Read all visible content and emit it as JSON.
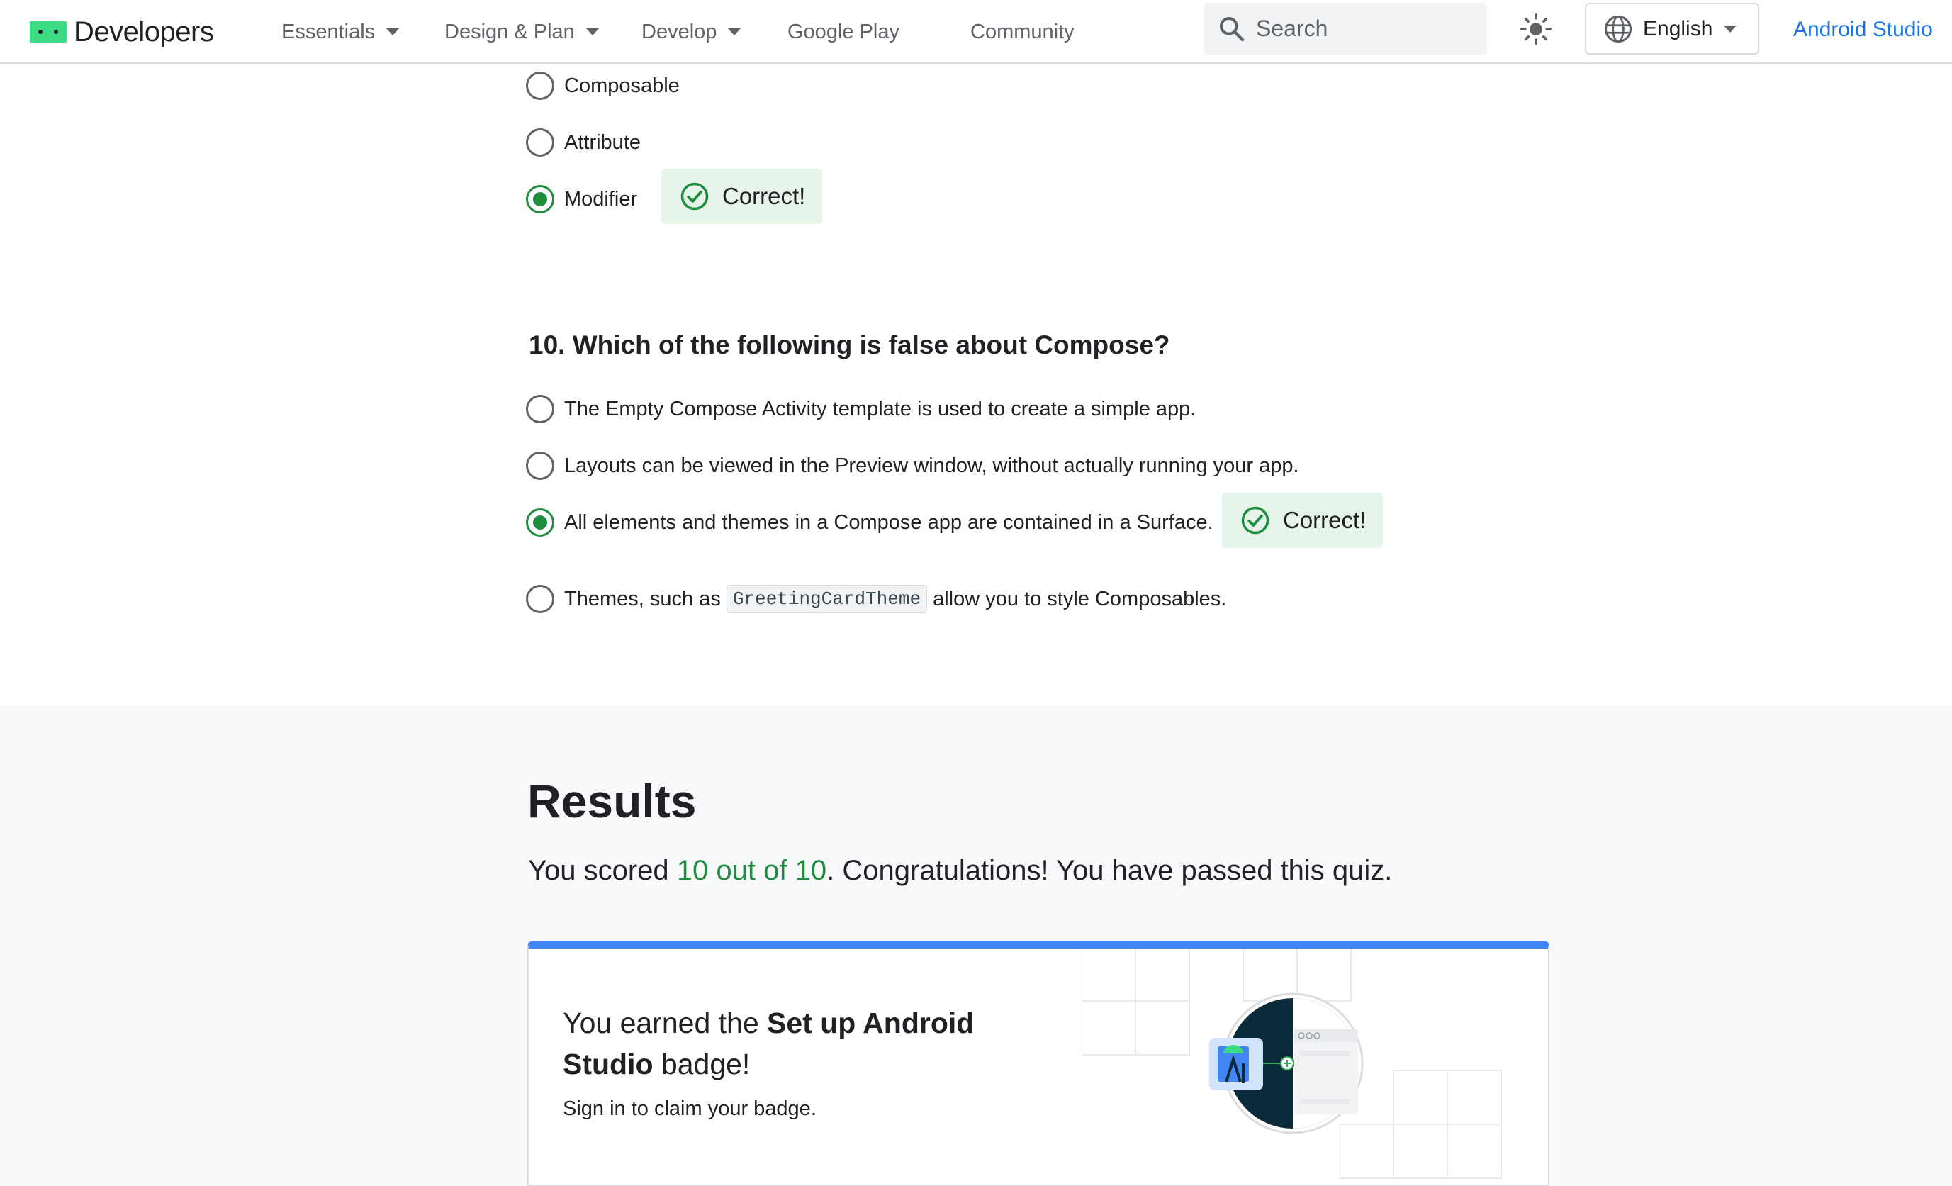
{
  "nav": {
    "brand": "Developers",
    "items": [
      {
        "label": "Essentials",
        "dropdown": true
      },
      {
        "label": "Design & Plan",
        "dropdown": true
      },
      {
        "label": "Develop",
        "dropdown": true
      },
      {
        "label": "Google Play",
        "dropdown": false
      },
      {
        "label": "Community",
        "dropdown": false
      }
    ],
    "search_placeholder": "Search",
    "language": "English",
    "studio_link": "Android Studio"
  },
  "quiz": {
    "q9_options": [
      {
        "label": "Composable",
        "selected": false
      },
      {
        "label": "Attribute",
        "selected": false
      },
      {
        "label": "Modifier",
        "selected": true
      }
    ],
    "q9_feedback": "Correct!",
    "q10": {
      "title": "10. Which of the following is false about Compose?",
      "options": [
        {
          "label": "The Empty Compose Activity template is used to create a simple app.",
          "selected": false
        },
        {
          "label": "Layouts can be viewed in the Preview window, without actually running your app.",
          "selected": false
        },
        {
          "label": "All elements and themes in a Compose app are contained in a Surface.",
          "selected": true
        },
        {
          "label_before": "Themes, such as",
          "code": "GreetingCardTheme",
          "label_after": "allow you to style Composables.",
          "selected": false
        }
      ],
      "feedback": "Correct!"
    }
  },
  "results": {
    "title": "Results",
    "score_prefix": "You scored ",
    "score": "10 out of 10",
    "score_suffix": ". Congratulations! You have passed this quiz.",
    "badge_prefix": "You earned the ",
    "badge_name": "Set up Android Studio",
    "badge_suffix": " badge!",
    "badge_sub": "Sign in to claim your badge."
  },
  "colors": {
    "accent_green": "#1e8e3e",
    "correct_bg": "#e6f4ea",
    "link_blue": "#1a73e8",
    "card_top": "#4285f4",
    "badge_dark": "#0b2a3a"
  }
}
